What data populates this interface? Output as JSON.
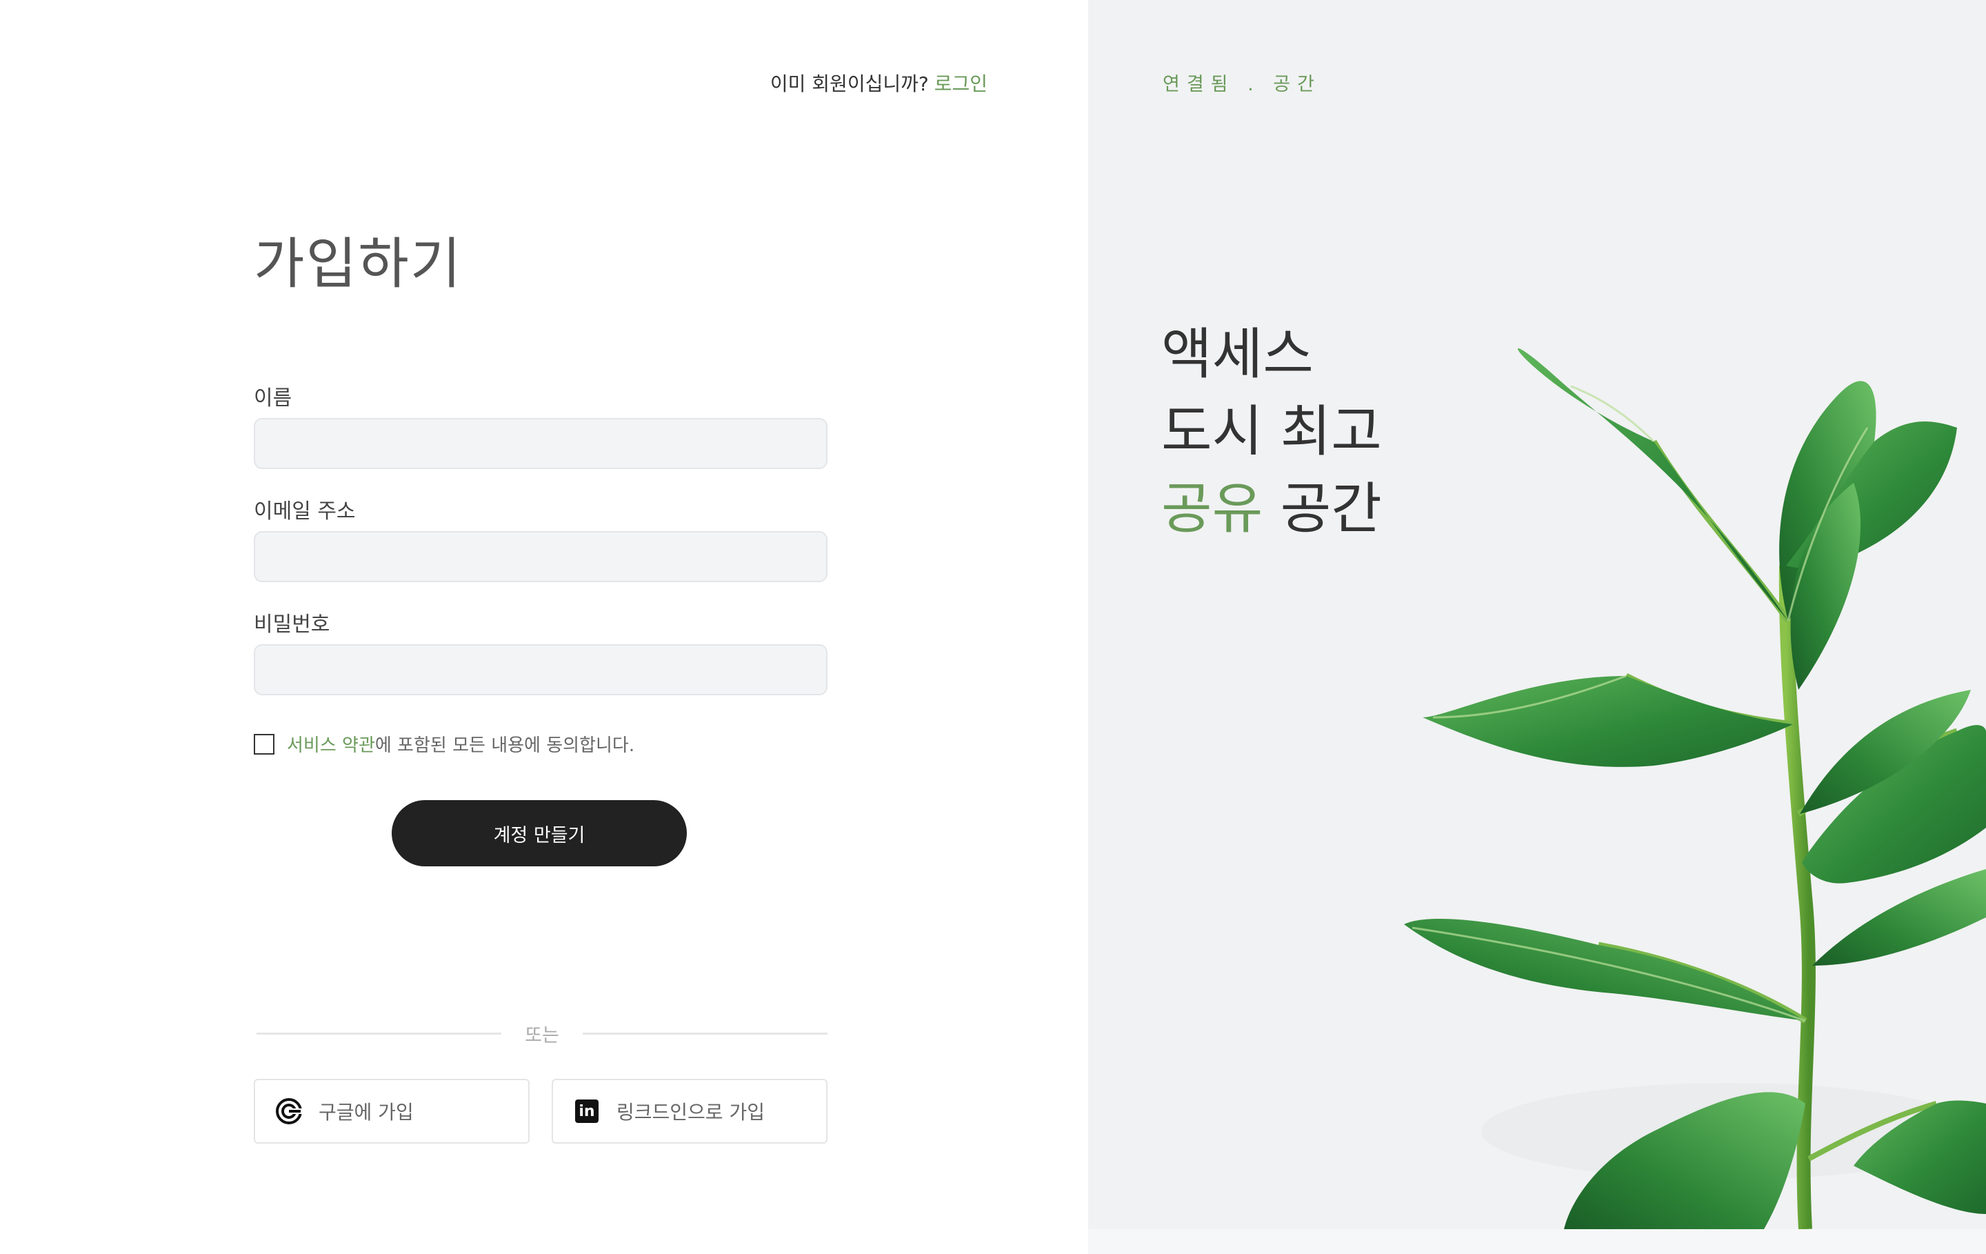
{
  "header": {
    "already_text": "이미 회원이십니까?",
    "login_link": "로그인"
  },
  "form": {
    "title": "가입하기",
    "name_label": "이름",
    "email_label": "이메일 주소",
    "password_label": "비밀번호",
    "name_value": "",
    "email_value": "",
    "password_value": "",
    "terms_link": "서비스 약관",
    "terms_rest": "에 포함된 모든 내용에 동의합니다.",
    "terms_checked": false,
    "submit_label": "계정 만들기"
  },
  "divider": {
    "label": "또는"
  },
  "social": {
    "google_label": "구글에 가입",
    "linkedin_label": "링크드인으로 가입",
    "google_icon": "google-icon",
    "linkedin_icon": "linkedin-icon"
  },
  "hero": {
    "brand": "연결됨 . 공간",
    "line1": "액세스",
    "line2": "도시 최고",
    "line3_accent": "공유",
    "line3_rest": "공간"
  },
  "colors": {
    "accent": "#6a9a5a",
    "button": "#222222",
    "hero_bg": "#f1f2f3",
    "leaf": "#2f8a3a"
  }
}
